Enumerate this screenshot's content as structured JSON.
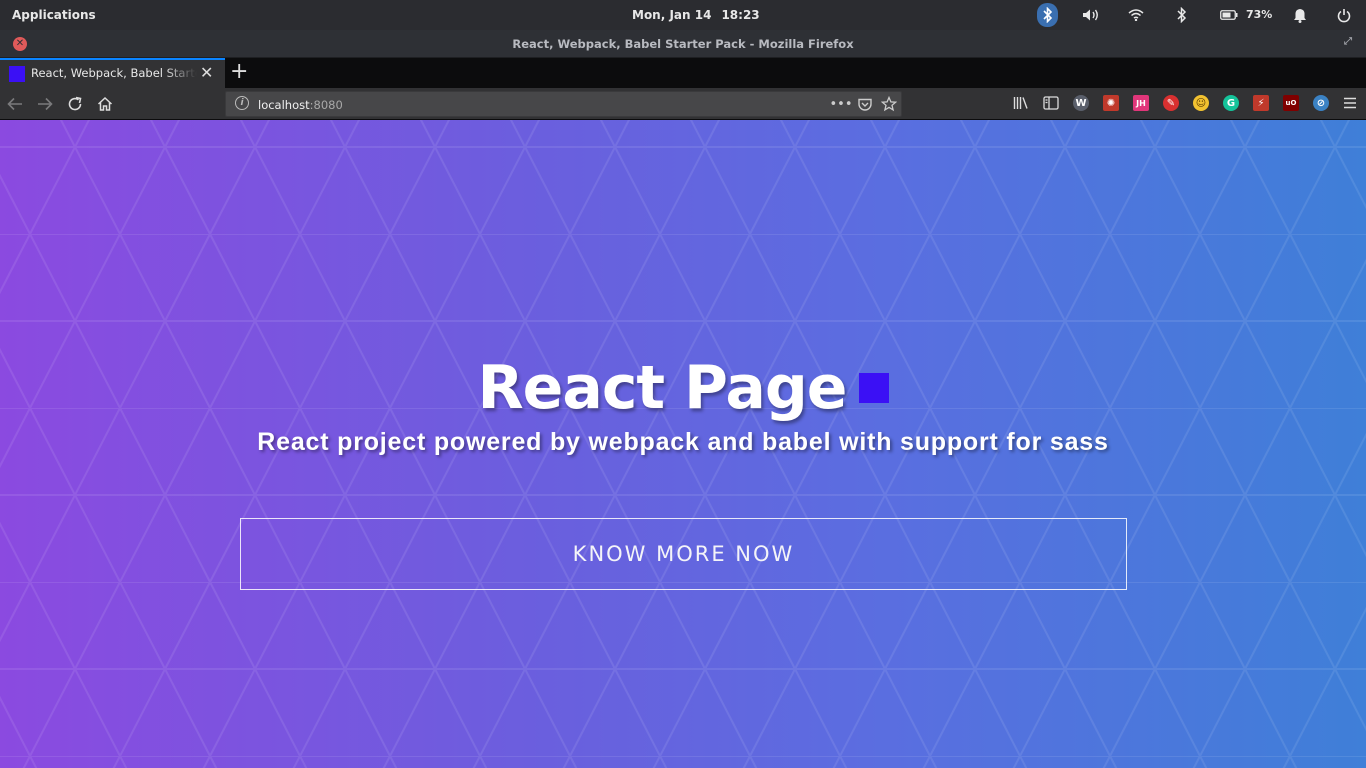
{
  "system_panel": {
    "applications_label": "Applications",
    "date": "Mon, Jan 14",
    "time": "18:23",
    "battery_percent": "73%"
  },
  "window": {
    "title": "React, Webpack, Babel Starter Pack - Mozilla Firefox"
  },
  "tab": {
    "title": "React, Webpack, Babel Starter Pack",
    "new_tab_label": "+"
  },
  "urlbar": {
    "host": "localhost",
    "port": ":8080"
  },
  "toolbar_extensions": [
    {
      "name": "wappalyzer-icon",
      "label": "W",
      "color": "#5a5f6b"
    },
    {
      "name": "wrapped-extension-icon",
      "label": "✺",
      "color": "#c0392b"
    },
    {
      "name": "jh-extension-icon",
      "label": "JH",
      "color": "#e0367a"
    },
    {
      "name": "flag-extension-icon",
      "label": "✎",
      "color": "#d93030"
    },
    {
      "name": "emoji-extension-icon",
      "label": "☺",
      "color": "#f2c230"
    },
    {
      "name": "grammarly-icon",
      "label": "G",
      "color": "#15c39a"
    },
    {
      "name": "redux-devtools-icon",
      "label": "⚡",
      "color": "#c0392b"
    },
    {
      "name": "ublock-origin-icon",
      "label": "uO",
      "color": "#800000"
    },
    {
      "name": "privacy-badger-icon",
      "label": "⊘",
      "color": "#3b82c4"
    }
  ],
  "hero": {
    "title": "React Page",
    "subtitle": "React project powered by webpack and babel with support for sass",
    "cta_label": "KNOW MORE NOW"
  },
  "colors": {
    "accent_square": "#3b10f5",
    "gradient_start": "#8b4ae0",
    "gradient_end": "#3f7fd8",
    "tab_highlight": "#0a84ff"
  }
}
